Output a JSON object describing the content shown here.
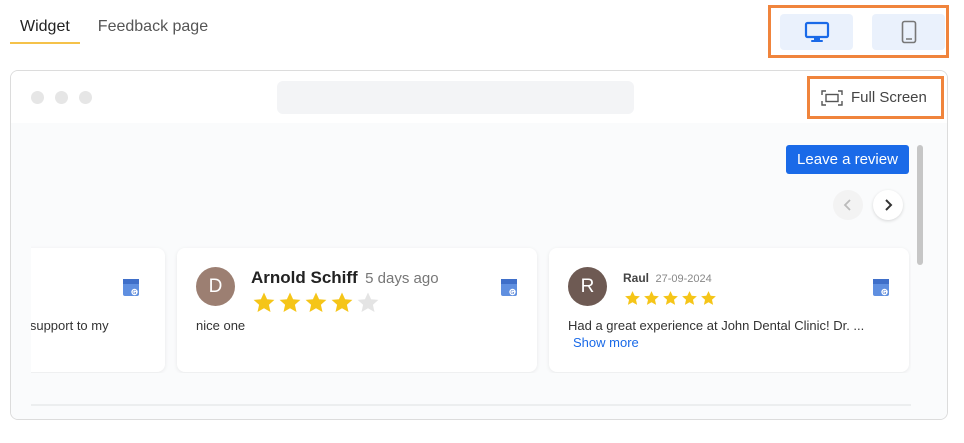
{
  "tabs": [
    {
      "label": "Widget",
      "active": true
    },
    {
      "label": "Feedback page",
      "active": false
    }
  ],
  "device_switch": {
    "selected": "desktop",
    "icons": [
      "desktop-icon",
      "mobile-icon"
    ]
  },
  "browser": {
    "fullscreen_label": "Full Screen",
    "leave_review_label": "Leave a review"
  },
  "reviews": [
    {
      "text": "n support to my"
    },
    {
      "initial": "D",
      "name": "Arnold Schiff",
      "date": "5 days ago",
      "rating": 4,
      "text": "nice one",
      "avatar_color": "#9c7f72"
    },
    {
      "initial": "R",
      "name": "Raul",
      "date": "27-09-2024",
      "rating": 5,
      "text": "Had a great experience at John Dental Clinic! Dr. ...",
      "show_more": "Show more",
      "avatar_color": "#6e5a53"
    }
  ],
  "colors": {
    "accent": "#1a6ae8",
    "highlight_border": "#f0843c",
    "star": "#f5c518",
    "star_empty": "#e4e4e4",
    "tab_underline": "#f5c24a"
  }
}
